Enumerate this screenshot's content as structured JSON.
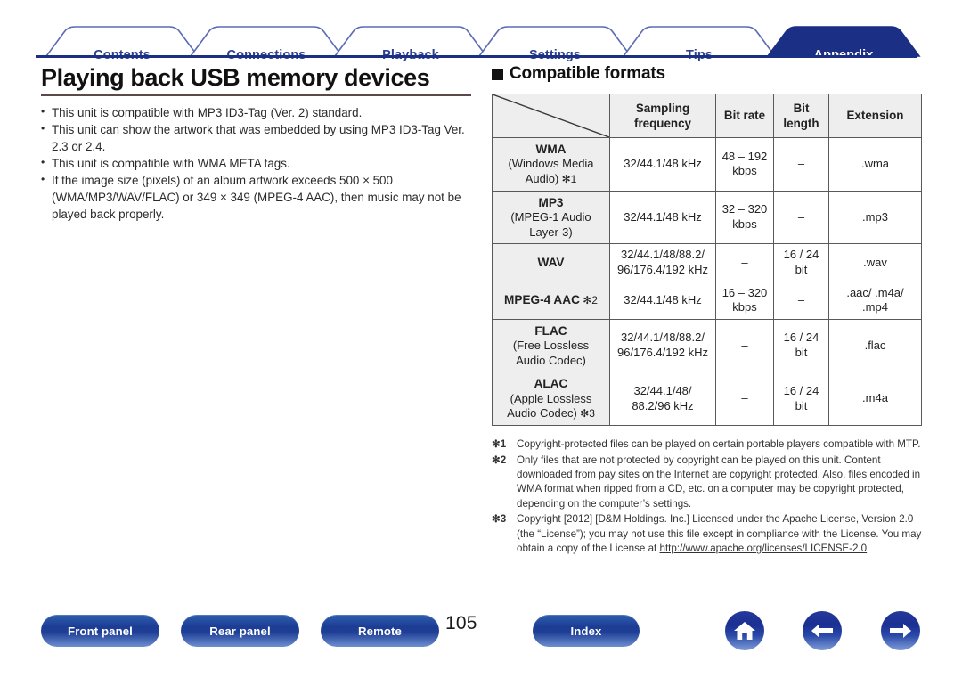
{
  "tabs": [
    {
      "label": "Contents",
      "active": false
    },
    {
      "label": "Connections",
      "active": false
    },
    {
      "label": "Playback",
      "active": false
    },
    {
      "label": "Settings",
      "active": false
    },
    {
      "label": "Tips",
      "active": false
    },
    {
      "label": "Appendix",
      "active": true
    }
  ],
  "left": {
    "title": "Playing back USB memory devices",
    "bullets": [
      "This unit is compatible with MP3 ID3-Tag (Ver. 2) standard.",
      "This unit can show the artwork that was embedded by using MP3 ID3-Tag Ver. 2.3 or 2.4.",
      "This unit is compatible with WMA META tags.",
      "If the image size (pixels) of an album artwork exceeds 500 × 500 (WMA/MP3/WAV/FLAC) or 349 × 349 (MPEG-4 AAC), then music may not be played back properly."
    ]
  },
  "right": {
    "section_title": "Compatible formats",
    "table": {
      "headers": [
        "",
        "Sampling frequency",
        "Bit rate",
        "Bit length",
        "Extension"
      ],
      "rows": [
        {
          "codec": "WMA",
          "subtitle": "(Windows Media Audio)",
          "note_ref": "✻1",
          "note_inline": false,
          "sampling": "32/44.1/48 kHz",
          "bitrate": "48 – 192 kbps",
          "bitlength": "–",
          "extension": ".wma"
        },
        {
          "codec": "MP3",
          "subtitle": "(MPEG-1 Audio Layer-3)",
          "note_ref": "",
          "note_inline": false,
          "sampling": "32/44.1/48 kHz",
          "bitrate": "32 – 320 kbps",
          "bitlength": "–",
          "extension": ".mp3"
        },
        {
          "codec": "WAV",
          "subtitle": "",
          "note_ref": "",
          "note_inline": false,
          "sampling": "32/44.1/48/88.2/ 96/176.4/192 kHz",
          "bitrate": "–",
          "bitlength": "16 / 24 bit",
          "extension": ".wav"
        },
        {
          "codec": "MPEG-4 AAC",
          "subtitle": "",
          "note_ref": "✻2",
          "note_inline": true,
          "sampling": "32/44.1/48 kHz",
          "bitrate": "16 – 320 kbps",
          "bitlength": "–",
          "extension": ".aac/ .m4a/ .mp4"
        },
        {
          "codec": "FLAC",
          "subtitle": "(Free Lossless Audio Codec)",
          "note_ref": "",
          "note_inline": false,
          "sampling": "32/44.1/48/88.2/ 96/176.4/192 kHz",
          "bitrate": "–",
          "bitlength": "16 / 24 bit",
          "extension": ".flac"
        },
        {
          "codec": "ALAC",
          "subtitle": "(Apple Lossless Audio Codec)",
          "note_ref": "✻3",
          "note_inline": false,
          "sampling": "32/44.1/48/ 88.2/96 kHz",
          "bitrate": "–",
          "bitlength": "16 / 24 bit",
          "extension": ".m4a"
        }
      ]
    },
    "footnotes": [
      {
        "tag": "✻1",
        "text": "Copyright-protected files can be played on certain portable players compatible with MTP.",
        "link": "",
        "text_after_link": ""
      },
      {
        "tag": "✻2",
        "text": "Only files that are not protected by copyright can be played on this unit. Content downloaded from pay sites on the Internet are copyright protected. Also, files encoded in WMA format when ripped from a CD, etc. on a computer may be copyright protected, depending on the computer’s settings.",
        "link": "",
        "text_after_link": ""
      },
      {
        "tag": "✻3",
        "text": "Copyright [2012] [D&M Holdings. Inc.] Licensed under the Apache License, Version 2.0 (the “License”); you may not use this file except in compliance with the License. You may obtain a copy of the License at ",
        "link": "http://www.apache.org/licenses/LICENSE-2.0",
        "text_after_link": ""
      }
    ]
  },
  "footer": {
    "buttons": [
      {
        "label": "Front panel"
      },
      {
        "label": "Rear panel"
      },
      {
        "label": "Remote"
      },
      {
        "label": "Index"
      }
    ],
    "page_number": "105",
    "icons": [
      "home-icon",
      "back-arrow-icon",
      "forward-arrow-icon"
    ]
  },
  "colors": {
    "tab_blue": "#2b3f8f",
    "active_tab_fill": "#1b2f85",
    "rule_brown": "#5a4a48",
    "table_header_bg": "#eeeeee"
  }
}
